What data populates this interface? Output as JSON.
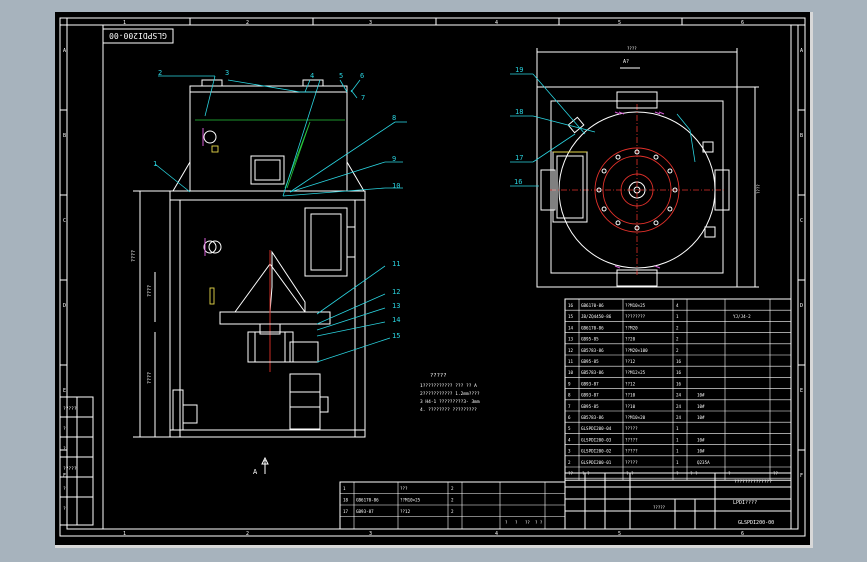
{
  "drawing": {
    "title_block_rotated": "GLSPDI200-00",
    "title_block_code": "GLSPDI200-00",
    "title_block_name": "LPDI????",
    "title_block_company": "??????????????",
    "title_block_extra": "?????",
    "top_grid": [
      "1",
      "2",
      "3",
      "4",
      "5",
      "6"
    ],
    "side_grid": [
      "A",
      "B",
      "C",
      "D",
      "E",
      "F"
    ],
    "view_arrow_label": "A",
    "top_view_label": "A?",
    "callouts": [
      "1",
      "2",
      "3",
      "4",
      "5",
      "6",
      "7",
      "8",
      "9",
      "10",
      "11",
      "12",
      "13",
      "14",
      "15",
      "16",
      "17",
      "18",
      "19"
    ],
    "notes_title": "?????",
    "notes": [
      "1??????????? ??? ?? A",
      "2??????????? 1.2mm????",
      "3 H4-1 ?????????3- 3mm",
      "4. ???????? ?????????"
    ],
    "dim_labels": [
      "????",
      "????",
      "????",
      "????",
      "????"
    ],
    "left_table_rows": [
      "?????",
      "?",
      "?",
      "?????",
      "?",
      "?"
    ]
  },
  "bom": {
    "rows": [
      {
        "no": "16",
        "code": "GB6170-86",
        "desc": "??M10×25",
        "qty": "4",
        "mat": "",
        "note": ""
      },
      {
        "no": "15",
        "code": "JB/ZQ4450-86",
        "desc": "????????",
        "qty": "1",
        "mat": "",
        "note": "YJ/J4-2"
      },
      {
        "no": "14",
        "code": "GB6170-86",
        "desc": "??M20",
        "qty": "2",
        "mat": "",
        "note": ""
      },
      {
        "no": "13",
        "code": "GB95-85",
        "desc": "??20",
        "qty": "2",
        "mat": "",
        "note": ""
      },
      {
        "no": "12",
        "code": "GB5783-86",
        "desc": "??M20×100",
        "qty": "2",
        "mat": "",
        "note": ""
      },
      {
        "no": "11",
        "code": "GB95-85",
        "desc": "??12",
        "qty": "16",
        "mat": "",
        "note": ""
      },
      {
        "no": "10",
        "code": "GB5783-86",
        "desc": "??M12×25",
        "qty": "16",
        "mat": "",
        "note": ""
      },
      {
        "no": "9",
        "code": "GB93-87",
        "desc": "??12",
        "qty": "16",
        "mat": "",
        "note": ""
      },
      {
        "no": "8",
        "code": "GB93-87",
        "desc": "??10",
        "qty": "24",
        "mat": "10#",
        "note": ""
      },
      {
        "no": "7",
        "code": "GB95-85",
        "desc": "??10",
        "qty": "24",
        "mat": "10#",
        "note": ""
      },
      {
        "no": "6",
        "code": "GB5783-86",
        "desc": "??M10×20",
        "qty": "24",
        "mat": "10#",
        "note": ""
      },
      {
        "no": "5",
        "code": "GLSPDI200-04",
        "desc": "?????",
        "qty": "1",
        "mat": "",
        "note": ""
      },
      {
        "no": "4",
        "code": "GLSPDI200-03",
        "desc": "?????",
        "qty": "1",
        "mat": "10#",
        "note": ""
      },
      {
        "no": "3",
        "code": "GLSPDI200-02",
        "desc": "?????",
        "qty": "1",
        "mat": "10#",
        "note": ""
      },
      {
        "no": "2",
        "code": "GLSPDI200-01",
        "desc": "?????",
        "qty": "1",
        "mat": "Q235A",
        "note": ""
      }
    ],
    "header": [
      "??",
      "?  ?",
      "?  ?",
      "?",
      "?  ?",
      "?",
      "??"
    ]
  },
  "bottom_table": {
    "rows": [
      {
        "no": "1",
        "code": "",
        "desc": "???",
        "qty": "2",
        "mat": ""
      },
      {
        "no": "18",
        "code": "GB6170-86",
        "desc": "??M10×25",
        "qty": "2",
        "mat": ""
      },
      {
        "no": "17",
        "code": "GB93-87",
        "desc": "??12",
        "qty": "2",
        "mat": ""
      }
    ],
    "scale_labels": [
      "?",
      "?",
      "??",
      "?  ?"
    ],
    "sheet_labels": [
      "??",
      "????",
      "?",
      "?",
      "1:1"
    ],
    "designer_labels": [
      "??",
      "??",
      "????",
      "??"
    ]
  },
  "colors": {
    "background": "#000000",
    "frame": "#ffffff",
    "leader": "#2ad4e0",
    "centerline": "#e0302a",
    "hidden": "#27c43a",
    "accent": "#e6d84a",
    "outer": "#a7b3bd"
  }
}
